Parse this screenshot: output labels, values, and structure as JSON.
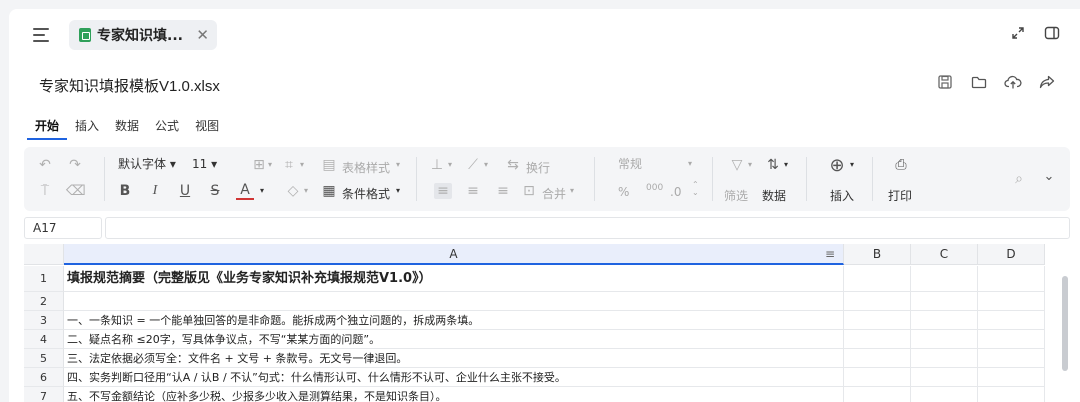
{
  "tab": {
    "label": "专家知识填...",
    "close": "✕"
  },
  "window": {
    "expand_icon": "expand-icon",
    "panel_icon": "sidebar-panel-icon"
  },
  "file": {
    "title": "专家知识填报模板V1.0.xlsx"
  },
  "ribbon_tabs": [
    {
      "label": "开始",
      "active": true
    },
    {
      "label": "插入"
    },
    {
      "label": "数据"
    },
    {
      "label": "公式"
    },
    {
      "label": "视图"
    }
  ],
  "toolbar": {
    "font_name": "默认字体",
    "font_size": "11",
    "table_style": "表格样式",
    "conditional_format": "条件格式",
    "wrap_text": "换行",
    "merge": "合并",
    "number_format": "常规",
    "decimal": ".0",
    "filter": "筛选",
    "data": "数据",
    "insert": "插入",
    "print": "打印",
    "percent": "%",
    "thousands": "000"
  },
  "formula_bar": {
    "cell_ref": "A17",
    "value": ""
  },
  "columns": [
    "A",
    "B",
    "C",
    "D"
  ],
  "rows": [
    {
      "num": "1",
      "a": "填报规范摘要（完整版见《业务专家知识补充填报规范V1.0》）",
      "bold": true
    },
    {
      "num": "2",
      "a": ""
    },
    {
      "num": "3",
      "a": "一、一条知识 = 一个能单独回答的是非命题。能拆成两个独立问题的，拆成两条填。"
    },
    {
      "num": "4",
      "a": "二、疑点名称 ≤20字，写具体争议点，不写“某某方面的问题”。"
    },
    {
      "num": "5",
      "a": "三、法定依据必须写全：文件名 + 文号 + 条款号。无文号一律退回。"
    },
    {
      "num": "6",
      "a": "四、实务判断口径用“认A / 认B / 不认”句式：什么情形认可、什么情形不认可、企业什么主张不接受。"
    },
    {
      "num": "7",
      "a": "五、不写金额结论（应补多少税、少报多少收入是测算结果，不是知识条目）。"
    }
  ]
}
